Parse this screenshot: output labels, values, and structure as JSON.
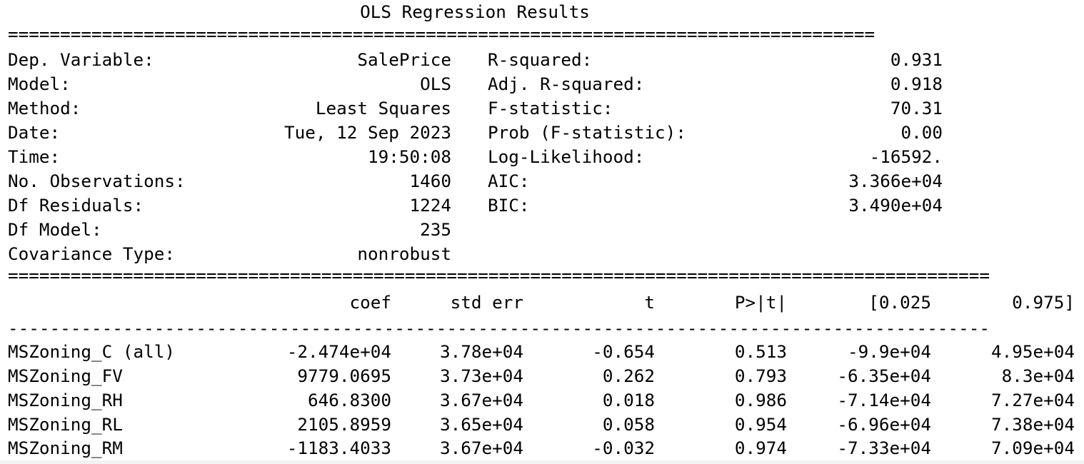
{
  "title": "OLS Regression Results",
  "rules": {
    "double_top": "===================================================================================",
    "double_mid": "==============================================================================================",
    "dash": "----------------------------------------------------------------------------------------------"
  },
  "summary": {
    "left": [
      {
        "label": "Dep. Variable:",
        "value": "SalePrice"
      },
      {
        "label": "Model:",
        "value": "OLS"
      },
      {
        "label": "Method:",
        "value": "Least Squares"
      },
      {
        "label": "Date:",
        "value": "Tue, 12 Sep 2023"
      },
      {
        "label": "Time:",
        "value": "19:50:08"
      },
      {
        "label": "No. Observations:",
        "value": "1460"
      },
      {
        "label": "Df Residuals:",
        "value": "1224"
      },
      {
        "label": "Df Model:",
        "value": "235"
      },
      {
        "label": "Covariance Type:",
        "value": "nonrobust"
      }
    ],
    "right": [
      {
        "label": "R-squared:",
        "value": "0.931"
      },
      {
        "label": "Adj. R-squared:",
        "value": "0.918"
      },
      {
        "label": "F-statistic:",
        "value": "70.31"
      },
      {
        "label": "Prob (F-statistic):",
        "value": "0.00"
      },
      {
        "label": "Log-Likelihood:",
        "value": "-16592."
      },
      {
        "label": "AIC:",
        "value": "3.366e+04"
      },
      {
        "label": "BIC:",
        "value": "3.490e+04"
      }
    ]
  },
  "coef_table": {
    "headers": [
      "coef",
      "std err",
      "t",
      "P>|t|",
      "[0.025",
      "0.975]"
    ],
    "rows": [
      {
        "name": "MSZoning_C (all)",
        "coef": "-2.474e+04",
        "std_err": "3.78e+04",
        "t": "-0.654",
        "p": "0.513",
        "ci_low": "-9.9e+04",
        "ci_high": "4.95e+04"
      },
      {
        "name": "MSZoning_FV",
        "coef": "9779.0695",
        "std_err": "3.73e+04",
        "t": "0.262",
        "p": "0.793",
        "ci_low": "-6.35e+04",
        "ci_high": "8.3e+04"
      },
      {
        "name": "MSZoning_RH",
        "coef": "646.8300",
        "std_err": "3.67e+04",
        "t": "0.018",
        "p": "0.986",
        "ci_low": "-7.14e+04",
        "ci_high": "7.27e+04"
      },
      {
        "name": "MSZoning_RL",
        "coef": "2105.8959",
        "std_err": "3.65e+04",
        "t": "0.058",
        "p": "0.954",
        "ci_low": "-6.96e+04",
        "ci_high": "7.38e+04"
      },
      {
        "name": "MSZoning_RM",
        "coef": "-1183.4033",
        "std_err": "3.67e+04",
        "t": "-0.032",
        "p": "0.974",
        "ci_low": "-7.33e+04",
        "ci_high": "7.09e+04"
      }
    ]
  }
}
